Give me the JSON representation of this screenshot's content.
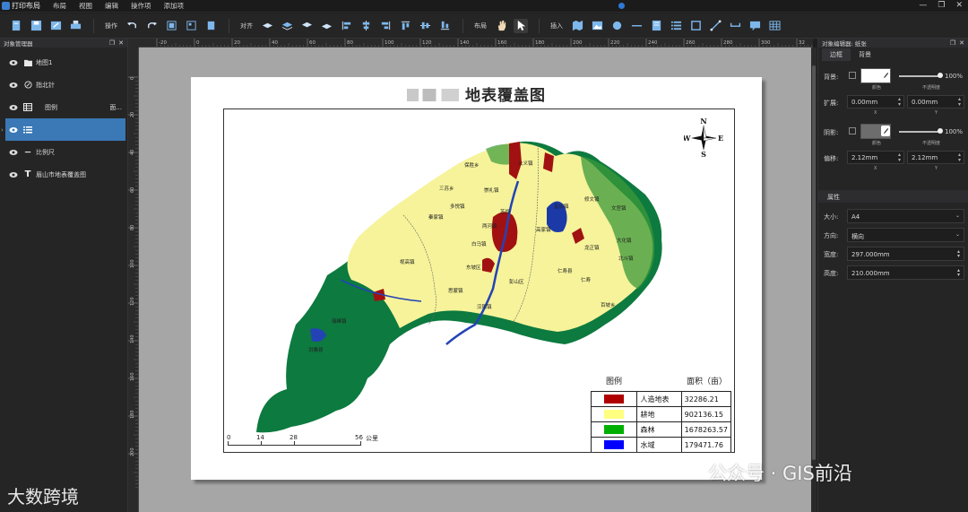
{
  "app": {
    "title": "打印布局",
    "menu": [
      "布局",
      "视图",
      "编辑",
      "操作项",
      "添加项"
    ],
    "window_controls": [
      "—",
      "❐",
      "✕"
    ]
  },
  "toolbar": {
    "labels": {
      "operate": "操作",
      "align": "对齐",
      "layout": "布局",
      "insert": "插入"
    }
  },
  "object_manager": {
    "title": "对象管理器",
    "items": [
      {
        "icon": "folder-icon",
        "label": "地图1",
        "extra": ""
      },
      {
        "icon": "compass-icon",
        "label": "指北针",
        "extra": ""
      },
      {
        "icon": "table-icon",
        "label": "图例",
        "extra": "面..."
      },
      {
        "icon": "list-icon",
        "label": "",
        "extra": ""
      },
      {
        "icon": "scale-icon",
        "label": "比例尺",
        "extra": ""
      },
      {
        "icon": "text-icon",
        "label": "眉山市地表覆盖图",
        "extra": ""
      }
    ]
  },
  "rulers": {
    "h_ticks": [
      "-20",
      "0",
      "20",
      "40",
      "60",
      "80",
      "100",
      "120",
      "140",
      "160",
      "180",
      "200",
      "220",
      "240",
      "260",
      "280",
      "300",
      "32"
    ],
    "v_ticks": [
      "0",
      "20",
      "40",
      "60",
      "80",
      "100",
      "120",
      "140",
      "160",
      "180",
      "200"
    ]
  },
  "layout_page": {
    "title": "地表覆盖图",
    "compass": {
      "n": "N",
      "s": "S",
      "e": "E",
      "w": "W"
    },
    "legend": {
      "header_left": "图例",
      "header_right": "面积（亩）",
      "rows": [
        {
          "name": "人造地表",
          "value": "32286.21",
          "color": "#b00000"
        },
        {
          "name": "耕地",
          "value": "902136.15",
          "color": "#ffff80"
        },
        {
          "name": "森林",
          "value": "1678263.57",
          "color": "#00b000"
        },
        {
          "name": "水域",
          "value": "179471.76",
          "color": "#0000ff"
        }
      ]
    },
    "scalebar": {
      "labels": [
        "0",
        "14",
        "28",
        "56"
      ],
      "unit": "公里"
    },
    "place_names": [
      "保胜乡",
      "公义镇",
      "三苏乡",
      "崇礼镇",
      "多悦镇",
      "秦家镇",
      "两河镇",
      "富加镇",
      "修文镇",
      "文宫镇",
      "高家镇",
      "白马镇",
      "龙正镇",
      "大化镇",
      "北斗镇",
      "仁寿县",
      "视高镇",
      "彭山区",
      "东坡区",
      "思蒙镇",
      "汉阳镇",
      "百坡乡",
      "苏祠",
      "仁寿",
      "瑞峰镇",
      "洪雅县"
    ]
  },
  "watermarks": {
    "bottom_right": "公众号 · GIS前沿",
    "bottom_left": "大数跨境"
  },
  "object_editor": {
    "title": "对象编辑器: 纸张",
    "tabs": [
      "边框",
      "背景"
    ],
    "bg_label": "背景:",
    "color_caption": "颜色",
    "opacity_caption": "不透明度",
    "bg_opacity": "100%",
    "expand_label": "扩展:",
    "expand_x": "0.00mm",
    "expand_y": "0.00mm",
    "x_caption": "X",
    "y_caption": "Y",
    "shadow_label": "阴影:",
    "shadow_opacity": "100%",
    "offset_label": "偏移:",
    "offset_x": "2.12mm",
    "offset_y": "2.12mm",
    "bg_color": "#ffffff",
    "shadow_color": "#6d6d6d",
    "section_props": "属性",
    "size_label": "大小:",
    "size_value": "A4",
    "orient_label": "方向:",
    "orient_value": "横向",
    "width_label": "宽度:",
    "width_value": "297.000mm",
    "height_label": "高度:",
    "height_value": "210.000mm"
  }
}
